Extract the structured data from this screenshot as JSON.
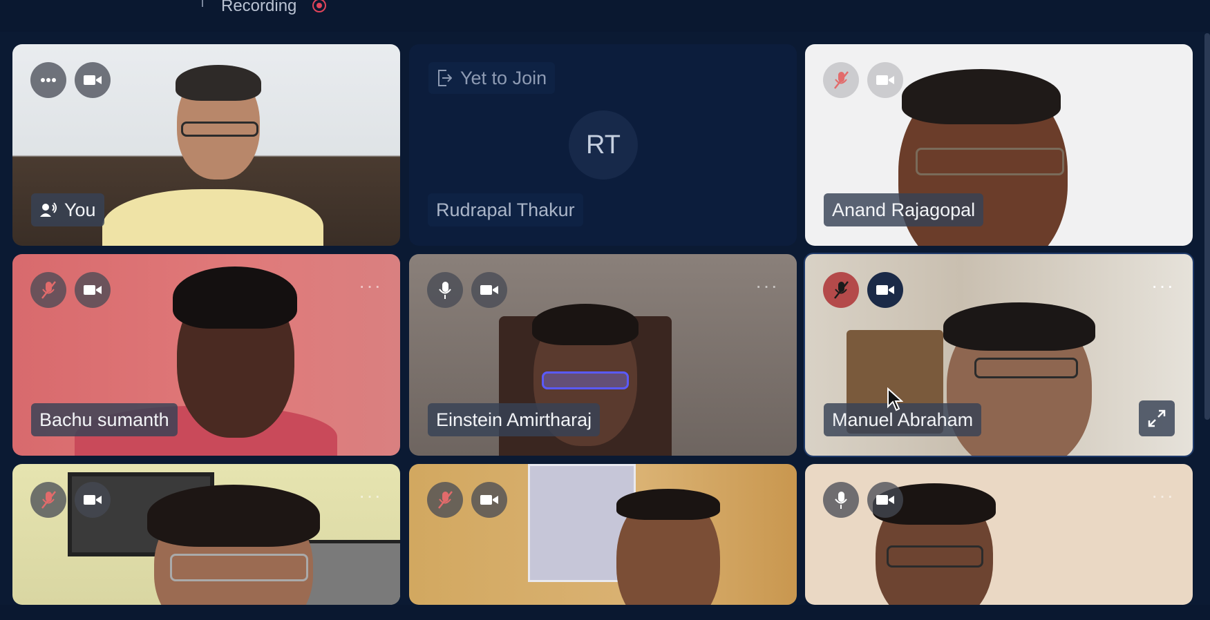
{
  "topbar": {
    "recording_label": "Recording"
  },
  "tiles": [
    {
      "name": "You"
    },
    {
      "status": "Yet to Join",
      "initials": "RT",
      "name": "Rudrapal Thakur"
    },
    {
      "name": "Anand Rajagopal"
    },
    {
      "name": "Bachu sumanth"
    },
    {
      "name": "Einstein Amirtharaj"
    },
    {
      "name": "Manuel Abraham"
    },
    {
      "name": ""
    },
    {
      "name": ""
    },
    {
      "name": ""
    }
  ],
  "icons": {
    "more": "more-options-icon",
    "camera": "camera-icon",
    "mic": "mic-icon",
    "mic_off": "mic-off-icon",
    "speaker": "speaking-icon",
    "exit": "exit-icon",
    "expand": "expand-icon",
    "recording": "recording-dot-icon"
  },
  "colors": {
    "background": "#0b1a33",
    "tile_empty": "#0c1d3c",
    "recording": "#e0445a"
  }
}
